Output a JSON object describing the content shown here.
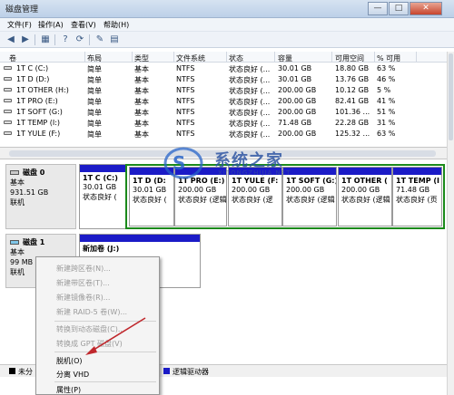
{
  "window": {
    "title": "磁盘管理",
    "min": "—",
    "max": "□",
    "close": "✕"
  },
  "menu": [
    "文件(F)",
    "操作(A)",
    "查看(V)",
    "帮助(H)"
  ],
  "toolbar_icons": [
    "back-icon",
    "forward-icon",
    "properties-icon",
    "help-icon",
    "refresh-icon",
    "settings-icon",
    "view-icon"
  ],
  "volume_table": {
    "headers": [
      "卷",
      "布局",
      "类型",
      "文件系统",
      "状态",
      "容量",
      "可用空间",
      "% 可用"
    ],
    "rows": [
      [
        "1T C (C:)",
        "简单",
        "基本",
        "NTFS",
        "状态良好 (...",
        "30.01 GB",
        "18.80 GB",
        "63 %"
      ],
      [
        "1T D (D:)",
        "简单",
        "基本",
        "NTFS",
        "状态良好 (...",
        "30.01 GB",
        "13.76 GB",
        "46 %"
      ],
      [
        "1T OTHER (H:)",
        "简单",
        "基本",
        "NTFS",
        "状态良好 (...",
        "200.00 GB",
        "10.12 GB",
        "5 %"
      ],
      [
        "1T PRO (E:)",
        "简单",
        "基本",
        "NTFS",
        "状态良好 (...",
        "200.00 GB",
        "82.41 GB",
        "41 %"
      ],
      [
        "1T SOFT (G:)",
        "简单",
        "基本",
        "NTFS",
        "状态良好 (...",
        "200.00 GB",
        "101.36 ...",
        "51 %"
      ],
      [
        "1T TEMP (I:)",
        "简单",
        "基本",
        "NTFS",
        "状态良好 (...",
        "71.48 GB",
        "22.28 GB",
        "31 %"
      ],
      [
        "1T YULE (F:)",
        "简单",
        "基本",
        "NTFS",
        "状态良好 (...",
        "200.00 GB",
        "125.32 ...",
        "63 %"
      ]
    ]
  },
  "disks": [
    {
      "title": "磁盘 0",
      "type": "基本",
      "size": "931.51 GB",
      "status": "联机",
      "partitions": [
        {
          "name": "1T C  (C:)",
          "size": "30.01 GB",
          "status": "状态良好 ("
        },
        {
          "name": "1T D  (D:",
          "size": "30.01 GB",
          "status": "状态良好 ("
        },
        {
          "name": "1T PRO  (E:)",
          "size": "200.00 GB",
          "status": "状态良好 (逻辑"
        },
        {
          "name": "1T YULE  (F:",
          "size": "200.00 GB",
          "status": "状态良好 (逻"
        },
        {
          "name": "1T SOFT  (G:)",
          "size": "200.00 GB",
          "status": "状态良好 (逻辑"
        },
        {
          "name": "1T OTHER  (",
          "size": "200.00 GB",
          "status": "状态良好 (逻辑"
        },
        {
          "name": "1T TEMP  (I",
          "size": "71.48 GB",
          "status": "状态良好 (页"
        }
      ]
    },
    {
      "title": "磁盘 1",
      "type": "基本",
      "size": "99 MB",
      "status": "联机",
      "partitions": [
        {
          "name": "新加卷 (J:)",
          "size": "",
          "status": ""
        }
      ]
    }
  ],
  "context_menu": {
    "items": [
      {
        "label": "新建跨区卷(N)...",
        "enabled": false
      },
      {
        "label": "新建带区卷(T)...",
        "enabled": false
      },
      {
        "label": "新建镜像卷(R)...",
        "enabled": false
      },
      {
        "label": "新建 RAID-5 卷(W)...",
        "enabled": false
      },
      {
        "label": "转换到动态磁盘(C)...",
        "enabled": false
      },
      {
        "label": "转换成 GPT 磁盘(V)",
        "enabled": false
      },
      {
        "label": "脱机(O)",
        "enabled": true
      },
      {
        "label": "分离 VHD",
        "enabled": true
      },
      {
        "label": "属性(P)",
        "enabled": true
      }
    ]
  },
  "legend": [
    {
      "label": "未分",
      "color": "#000000"
    },
    {
      "label": "逻辑驱动器",
      "color": "#1b1bc7"
    }
  ],
  "watermark": {
    "text": "系统之家",
    "url": "XITONGZHIJIA.NET"
  },
  "colors": {
    "partition_bar": "#1b1bc7",
    "extended_border": "#1b8a1b",
    "arrow": "#c0282d"
  }
}
